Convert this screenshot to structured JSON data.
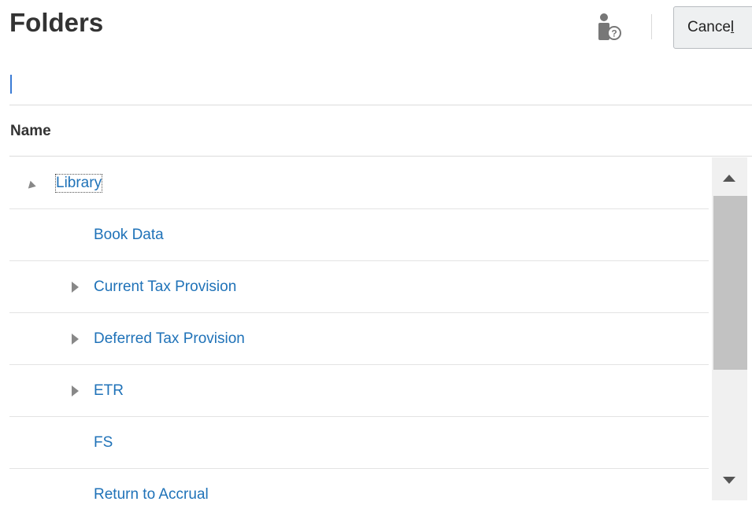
{
  "header": {
    "title": "Folders",
    "help_icon": "user-help-icon",
    "cancel": {
      "before": "Cance",
      "accesskey": "l"
    }
  },
  "table": {
    "column_header": "Name",
    "rows": [
      {
        "label": "Library",
        "expander": "expanded",
        "level": 0,
        "focused": true
      },
      {
        "label": "Book Data",
        "expander": "none",
        "level": 1
      },
      {
        "label": "Current Tax Provision",
        "expander": "collapsed",
        "level": 1
      },
      {
        "label": "Deferred Tax Provision",
        "expander": "collapsed",
        "level": 1
      },
      {
        "label": "ETR",
        "expander": "collapsed",
        "level": 1
      },
      {
        "label": "FS",
        "expander": "none",
        "level": 1
      },
      {
        "label": "Return to Accrual",
        "expander": "none",
        "level": 1
      }
    ]
  },
  "colors": {
    "link": "#1f72b8",
    "header_text": "#333333",
    "button_bg": "#eef0f1"
  }
}
